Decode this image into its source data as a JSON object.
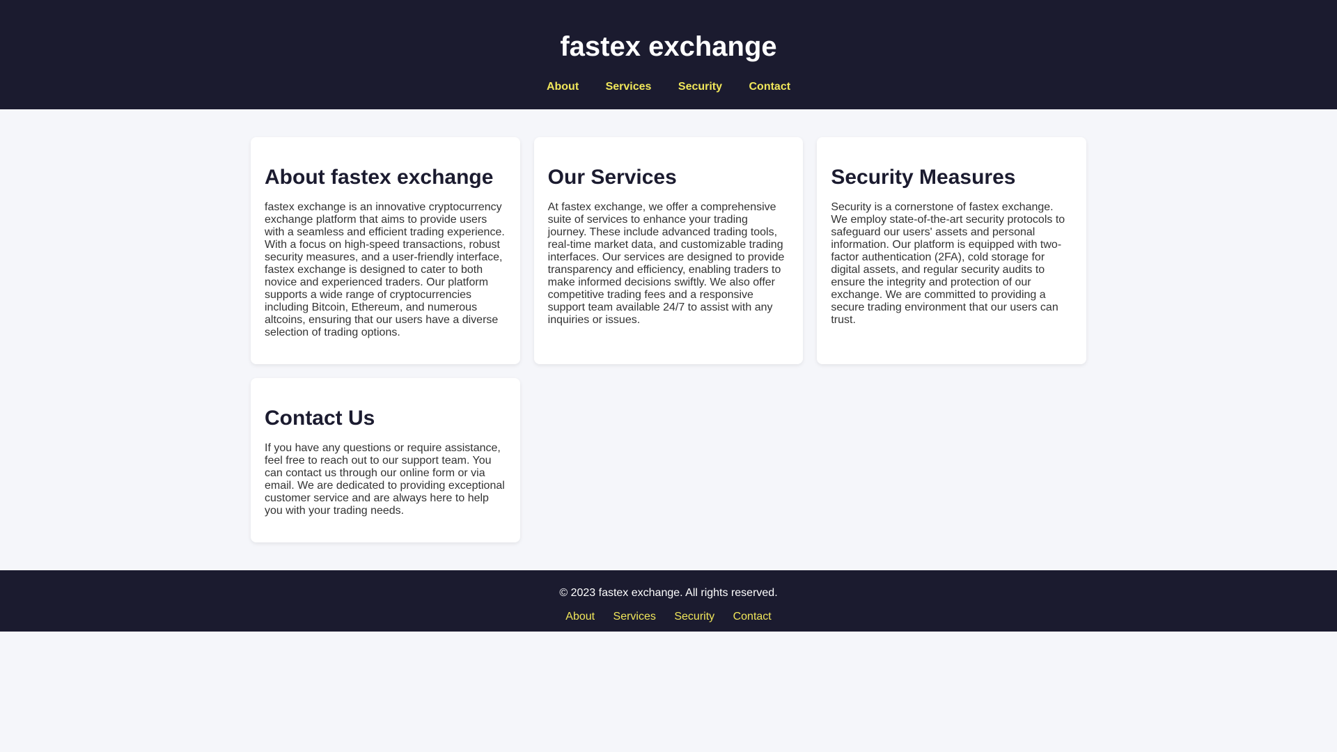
{
  "header": {
    "title": "fastex exchange",
    "nav": [
      "About",
      "Services",
      "Security",
      "Contact"
    ]
  },
  "sections": [
    {
      "title": "About fastex exchange",
      "body": "fastex exchange is an innovative cryptocurrency exchange platform that aims to provide users with a seamless and efficient trading experience. With a focus on high-speed transactions, robust security measures, and a user-friendly interface, fastex exchange is designed to cater to both novice and experienced traders. Our platform supports a wide range of cryptocurrencies including Bitcoin, Ethereum, and numerous altcoins, ensuring that our users have a diverse selection of trading options."
    },
    {
      "title": "Our Services",
      "body": "At fastex exchange, we offer a comprehensive suite of services to enhance your trading journey. These include advanced trading tools, real-time market data, and customizable trading interfaces. Our services are designed to provide transparency and efficiency, enabling traders to make informed decisions swiftly. We also offer competitive trading fees and a responsive support team available 24/7 to assist with any inquiries or issues."
    },
    {
      "title": "Security Measures",
      "body": "Security is a cornerstone of fastex exchange. We employ state-of-the-art security protocols to safeguard our users' assets and personal information. Our platform is equipped with two-factor authentication (2FA), cold storage for digital assets, and regular security audits to ensure the integrity and protection of our exchange. We are committed to providing a secure trading environment that our users can trust."
    },
    {
      "title": "Contact Us",
      "body": "If you have any questions or require assistance, feel free to reach out to our support team. You can contact us through our online form or via email. We are dedicated to providing exceptional customer service and are always here to help you with your trading needs."
    }
  ],
  "footer": {
    "copyright": "© 2023 fastex exchange. All rights reserved.",
    "links": [
      "About",
      "Services",
      "Security",
      "Contact"
    ]
  }
}
